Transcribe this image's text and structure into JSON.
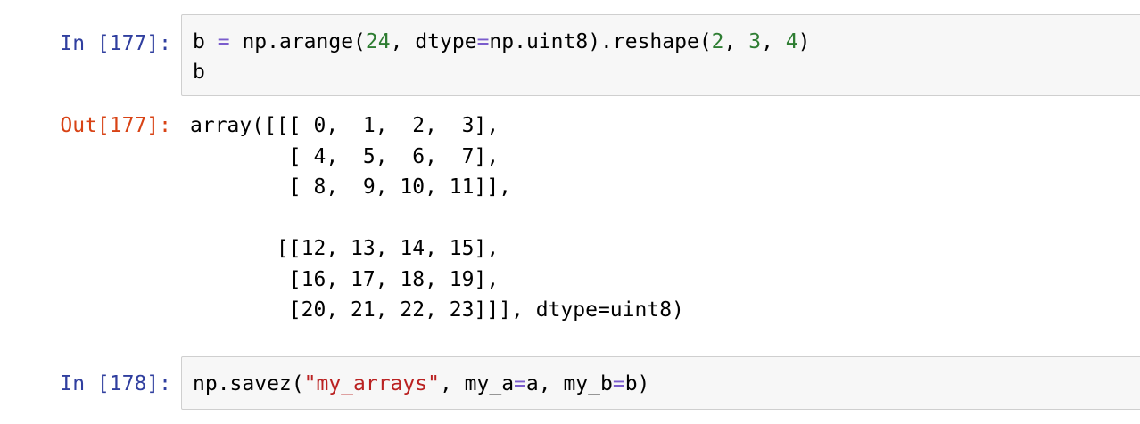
{
  "cells": [
    {
      "prompt": "In [177]:",
      "code_lines": [
        "b = np.arange(24, dtype=np.uint8).reshape(2, 3, 4)",
        "b"
      ],
      "tokens": {
        "var_b": "b",
        "eq": "=",
        "call_start": "np.arange(",
        "arg_24": "24",
        "dtype_part": ", dtype",
        "eq2": "=",
        "reshape_part": "np.uint8).reshape(",
        "arg_2": "2",
        "sep1": ", ",
        "arg_3": "3",
        "sep2": ", ",
        "arg_4": "4",
        "close": ")",
        "line2": "b"
      }
    },
    {
      "prompt": "Out[177]:",
      "output": "array([[[ 0,  1,  2,  3],\n        [ 4,  5,  6,  7],\n        [ 8,  9, 10, 11]],\n\n       [[12, 13, 14, 15],\n        [16, 17, 18, 19],\n        [20, 21, 22, 23]]], dtype=uint8)"
    },
    {
      "prompt": "In [178]:",
      "tokens": {
        "call_start": "np.savez(",
        "string_arg": "\"my_arrays\"",
        "mid": ", my_a",
        "eq1": "=",
        "mid2": "a, my_b",
        "eq2": "=",
        "end": "b)"
      }
    }
  ]
}
